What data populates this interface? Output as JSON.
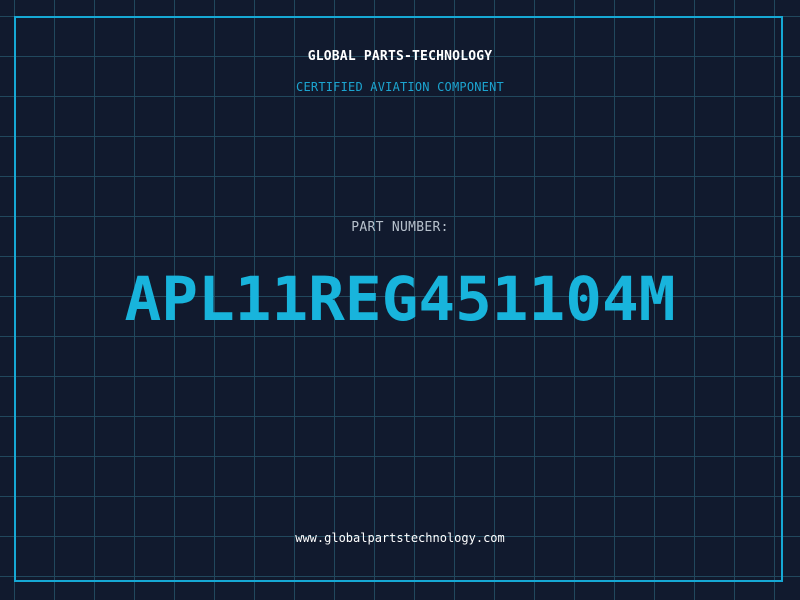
{
  "header": {
    "company": "GLOBAL PARTS-TECHNOLOGY",
    "subtitle": "CERTIFIED AVIATION COMPONENT"
  },
  "part": {
    "label": "PART NUMBER:",
    "number": "APL11REG451104M"
  },
  "footer": {
    "website": "www.globalpartstechnology.com"
  },
  "colors": {
    "background": "#111a2e",
    "grid": "#21485d",
    "accent": "#18b4dc",
    "text": "#ffffff"
  }
}
